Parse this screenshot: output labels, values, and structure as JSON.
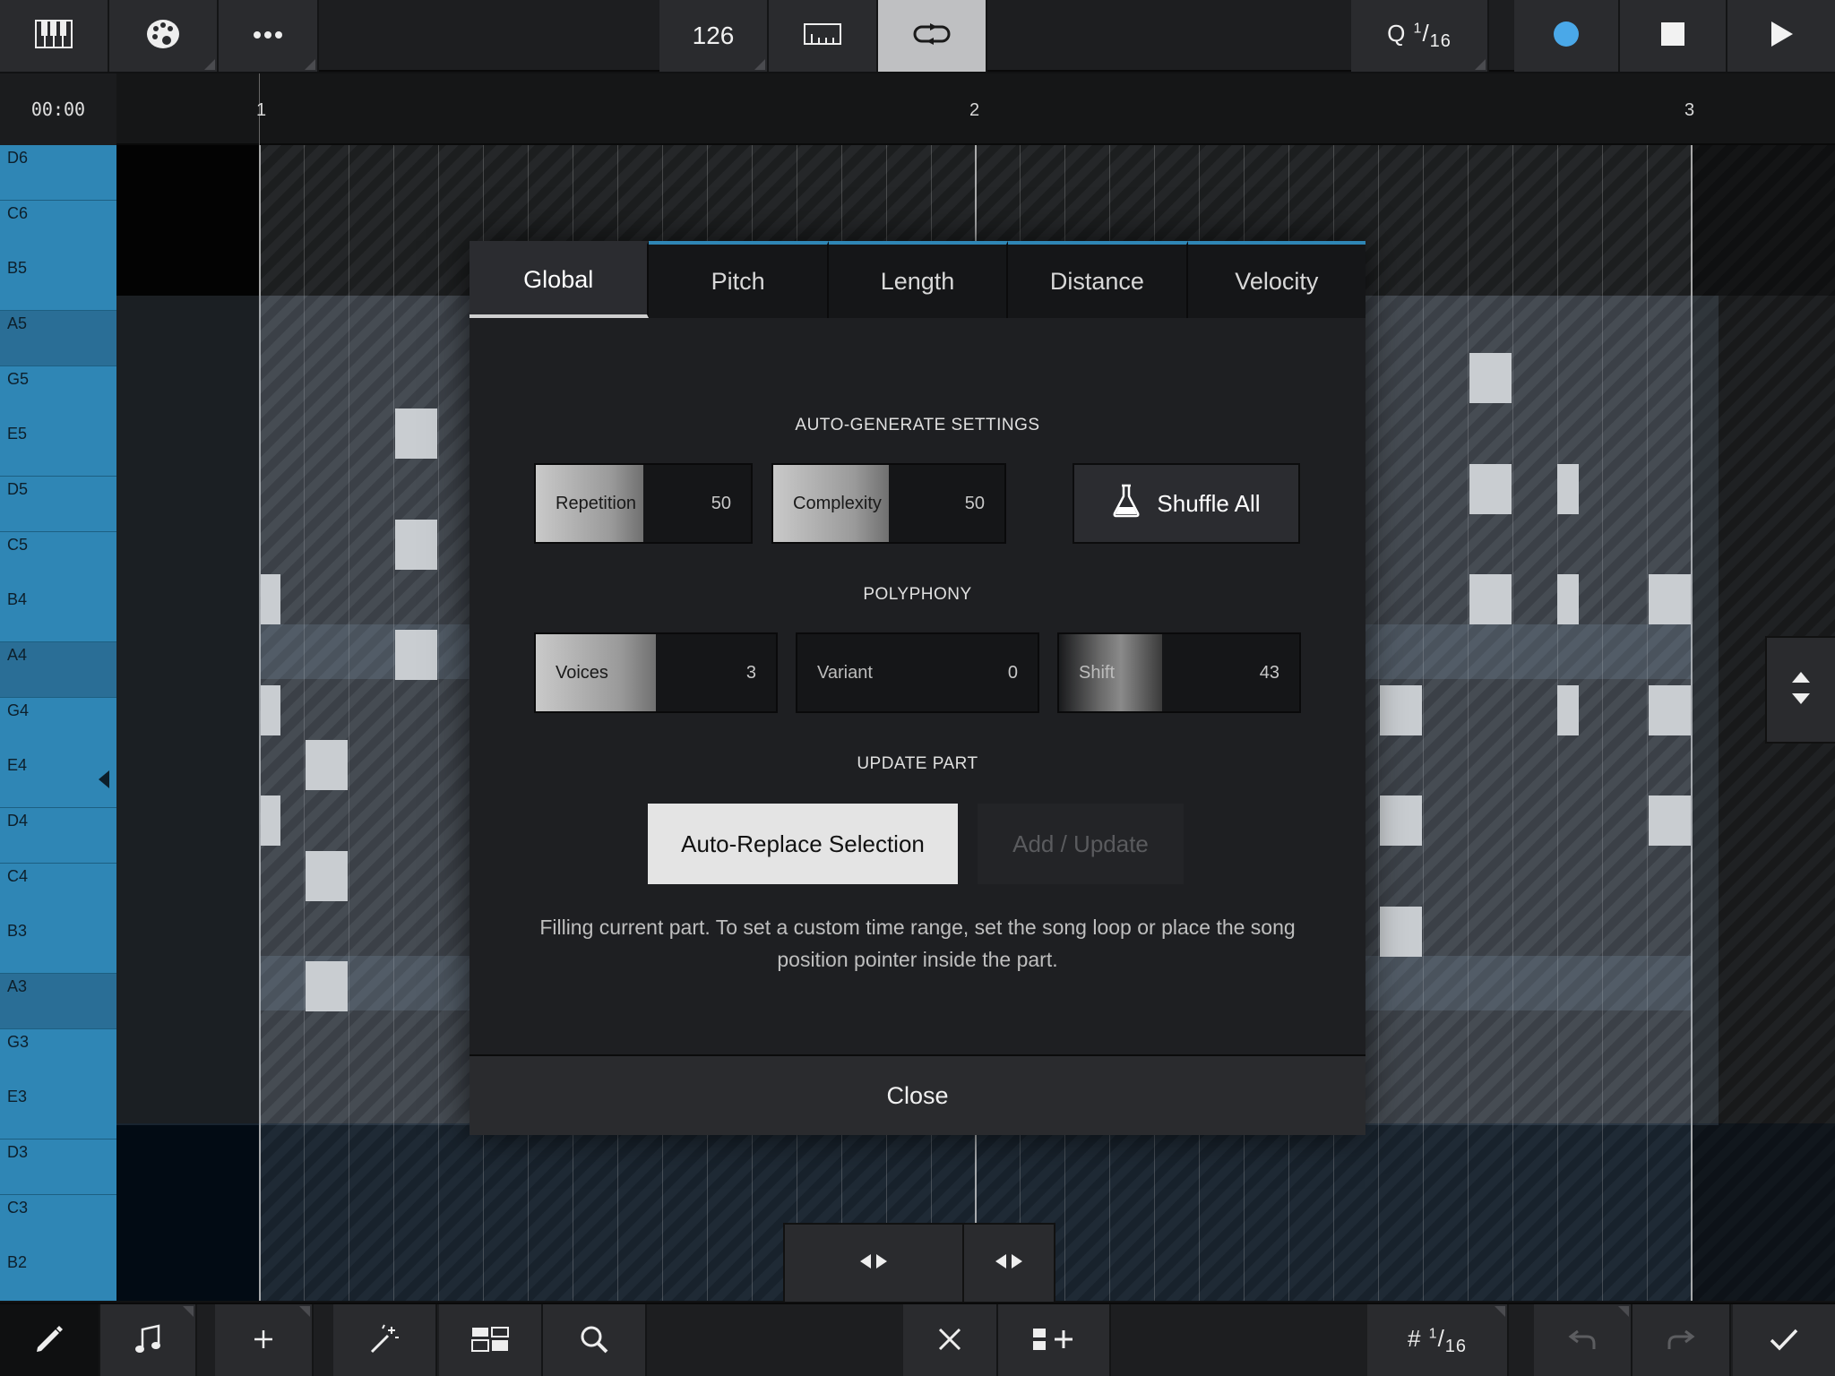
{
  "toolbar": {
    "tempo": "126",
    "quantize_prefix": "Q",
    "quantize_num": "1",
    "quantize_den": "16",
    "icons": [
      "piano-keys-icon",
      "palette-icon",
      "more-icon",
      "metronome-icon",
      "loop-icon",
      "record-icon",
      "stop-icon",
      "play-icon"
    ],
    "record_color": "#4aa8e8"
  },
  "ruler": {
    "time": "00:00",
    "bars": [
      "1",
      "2",
      "3"
    ]
  },
  "keys": [
    "D6",
    "C6",
    "B5",
    "A5",
    "G5",
    "E5",
    "D5",
    "C5",
    "B4",
    "A4",
    "G4",
    "E4",
    "D4",
    "C4",
    "B3",
    "A3",
    "G3",
    "E3",
    "D3",
    "C3",
    "B2"
  ],
  "dialog": {
    "tabs": [
      "Global",
      "Pitch",
      "Length",
      "Distance",
      "Velocity"
    ],
    "active_tab": "Global",
    "auto_generate_title": "AUTO-GENERATE SETTINGS",
    "repetition": {
      "label": "Repetition",
      "value": "50",
      "level": 0.5
    },
    "complexity": {
      "label": "Complexity",
      "value": "50",
      "level": 0.5
    },
    "shuffle_label": "Shuffle All",
    "polyphony_title": "POLYPHONY",
    "voices": {
      "label": "Voices",
      "value": "3",
      "level": 0.5
    },
    "variant": {
      "label": "Variant",
      "value": "0",
      "level": 0.0
    },
    "shift": {
      "label": "Shift",
      "value": "43",
      "level": 0.43
    },
    "update_title": "UPDATE PART",
    "replace_label": "Auto-Replace Selection",
    "add_label": "Add / Update",
    "info_text": "Filling current part. To set a custom time range, set the song loop or place the song position pointer inside the part.",
    "close_label": "Close"
  },
  "bottom": {
    "grid_prefix": "#",
    "grid_num": "1",
    "grid_den": "16",
    "icons": [
      "pencil-icon",
      "note-icon",
      "plus-icon",
      "magic-wand-icon",
      "layout-icon",
      "search-icon",
      "close-icon",
      "add-track-icon",
      "undo-icon",
      "redo-icon",
      "checkmark-icon"
    ]
  },
  "colors": {
    "accent_blue": "#2f86b5",
    "note": "#d9d9d9"
  }
}
